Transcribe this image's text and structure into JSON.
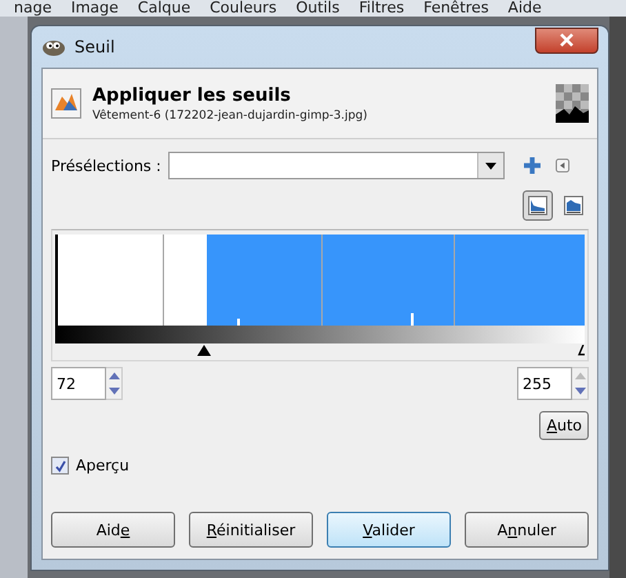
{
  "background_menu": [
    "nage",
    "Image",
    "Calque",
    "Couleurs",
    "Outils",
    "Filtres",
    "Fenêtres",
    "Aide"
  ],
  "window": {
    "title": "Seuil"
  },
  "header": {
    "title": "Appliquer les seuils",
    "subtitle": "Vêtement-6 (172202-jean-dujardin-gimp-3.jpg)"
  },
  "presets": {
    "label": "Présélections :"
  },
  "histogram_scale": [
    {
      "kind": "linear",
      "selected": true
    },
    {
      "kind": "log",
      "selected": false
    }
  ],
  "threshold": {
    "level": 0.282,
    "low": "72",
    "high": "255"
  },
  "preview": {
    "label": "Aperçu",
    "checked": true
  },
  "auto_button": {
    "label": "Auto"
  },
  "buttons": [
    {
      "label": "Aide",
      "default": false
    },
    {
      "label": "Réinitialiser",
      "default": false
    },
    {
      "label": "Valider",
      "default": true
    },
    {
      "label": "Annuler",
      "default": false
    }
  ]
}
